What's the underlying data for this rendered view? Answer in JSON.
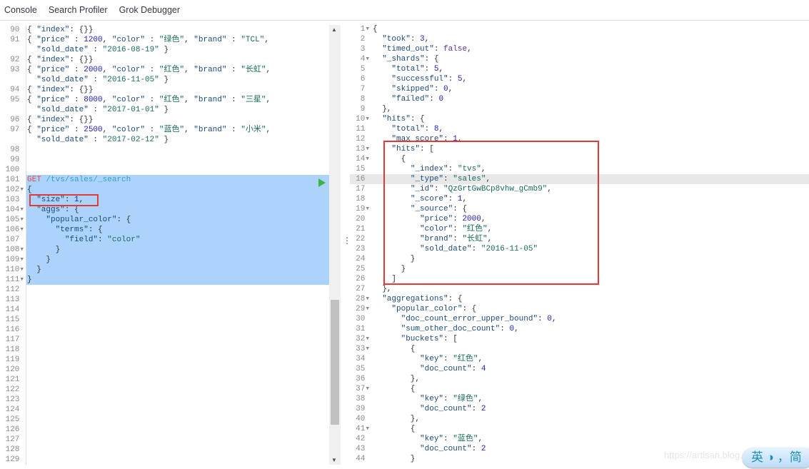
{
  "nav": {
    "tabs": [
      "Console",
      "Search Profiler",
      "Grok Debugger"
    ]
  },
  "request_editor": {
    "rows": [
      {
        "n": "90",
        "t": "{ \"index\": {}}"
      },
      {
        "n": "91",
        "t": "{ \"price\" : 1200, \"color\" : \"绿色\", \"brand\" : \"TCL\","
      },
      {
        "n": "",
        "t": "  \"sold_date\" : \"2016-08-19\" }"
      },
      {
        "n": "92",
        "t": "{ \"index\": {}}"
      },
      {
        "n": "93",
        "t": "{ \"price\" : 2000, \"color\" : \"红色\", \"brand\" : \"长虹\","
      },
      {
        "n": "",
        "t": "  \"sold_date\" : \"2016-11-05\" }"
      },
      {
        "n": "94",
        "t": "{ \"index\": {}}"
      },
      {
        "n": "95",
        "t": "{ \"price\" : 8000, \"color\" : \"红色\", \"brand\" : \"三星\","
      },
      {
        "n": "",
        "t": "  \"sold_date\" : \"2017-01-01\" }"
      },
      {
        "n": "96",
        "t": "{ \"index\": {}}"
      },
      {
        "n": "97",
        "t": "{ \"price\" : 2500, \"color\" : \"蓝色\", \"brand\" : \"小米\","
      },
      {
        "n": "",
        "t": "  \"sold_date\" : \"2017-02-12\" }"
      },
      {
        "n": "98",
        "t": ""
      },
      {
        "n": "99",
        "t": ""
      },
      {
        "n": "100",
        "t": ""
      },
      {
        "n": "101",
        "t": "GET /tvs/sales/_search",
        "sel": true
      },
      {
        "n": "102",
        "t": "{",
        "sel": true,
        "f": true
      },
      {
        "n": "103",
        "t": "  \"size\": 1,",
        "sel": true
      },
      {
        "n": "104",
        "t": "  \"aggs\": {",
        "sel": true,
        "f": true
      },
      {
        "n": "105",
        "t": "    \"popular_color\": {",
        "sel": true,
        "f": true
      },
      {
        "n": "106",
        "t": "      \"terms\": {",
        "sel": true,
        "f": true
      },
      {
        "n": "107",
        "t": "        \"field\": \"color\"",
        "sel": true
      },
      {
        "n": "108",
        "t": "      }",
        "sel": true,
        "f": true
      },
      {
        "n": "109",
        "t": "    }",
        "sel": true,
        "f": true
      },
      {
        "n": "110",
        "t": "  }",
        "sel": true,
        "f": true
      },
      {
        "n": "111",
        "t": "}",
        "sel": true,
        "f": true
      },
      {
        "n": "112",
        "t": ""
      },
      {
        "n": "113",
        "t": ""
      },
      {
        "n": "114",
        "t": ""
      },
      {
        "n": "115",
        "t": ""
      },
      {
        "n": "116",
        "t": ""
      },
      {
        "n": "117",
        "t": ""
      },
      {
        "n": "118",
        "t": ""
      },
      {
        "n": "119",
        "t": ""
      },
      {
        "n": "120",
        "t": ""
      },
      {
        "n": "121",
        "t": ""
      },
      {
        "n": "122",
        "t": ""
      },
      {
        "n": "123",
        "t": ""
      },
      {
        "n": "124",
        "t": ""
      },
      {
        "n": "125",
        "t": ""
      },
      {
        "n": "126",
        "t": ""
      },
      {
        "n": "127",
        "t": ""
      },
      {
        "n": "128",
        "t": ""
      },
      {
        "n": "129",
        "t": ""
      }
    ]
  },
  "response_editor": {
    "active_line": 16,
    "lines": [
      "{",
      "  \"took\": 3,",
      "  \"timed_out\": false,",
      "  \"_shards\": {",
      "    \"total\": 5,",
      "    \"successful\": 5,",
      "    \"skipped\": 0,",
      "    \"failed\": 0",
      "  },",
      "  \"hits\": {",
      "    \"total\": 8,",
      "    \"max_score\": 1,",
      "    \"hits\": [",
      "      {",
      "        \"_index\": \"tvs\",",
      "        \"_type\": \"sales\",",
      "        \"_id\": \"QzGrtGwBCp8vhw_gCmb9\",",
      "        \"_score\": 1,",
      "        \"_source\": {",
      "          \"price\": 2000,",
      "          \"color\": \"红色\",",
      "          \"brand\": \"长虹\",",
      "          \"sold_date\": \"2016-11-05\"",
      "        }",
      "      }",
      "    ]",
      "  },",
      "  \"aggregations\": {",
      "    \"popular_color\": {",
      "      \"doc_count_error_upper_bound\": 0,",
      "      \"sum_other_doc_count\": 0,",
      "      \"buckets\": [",
      "        {",
      "          \"key\": \"红色\",",
      "          \"doc_count\": 4",
      "        },",
      "        {",
      "          \"key\": \"绿色\",",
      "          \"doc_count\": 2",
      "        },",
      "        {",
      "          \"key\": \"蓝色\",",
      "          \"doc_count\": 2",
      "        }"
    ]
  },
  "watermark": "https://artisan.blog.csdn.net",
  "ime": {
    "text": "英 ◑ ，简"
  },
  "colors": {
    "highlight_box": "#e53935",
    "selection": "#acd3fb",
    "run": "#3ab54a"
  }
}
